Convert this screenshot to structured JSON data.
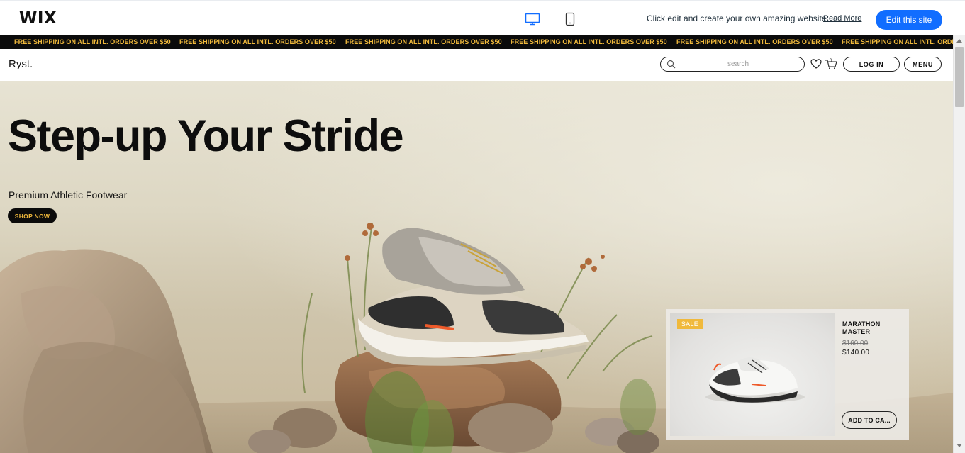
{
  "wix_bar": {
    "logo": "WIX",
    "devices": {
      "desktop_icon": "desktop-icon",
      "mobile_icon": "mobile-icon"
    },
    "promo_text": "Click edit and create your own amazing website",
    "read_more": "Read More",
    "edit_button": "Edit this site",
    "accent_color": "#116dff"
  },
  "announcement": {
    "items": [
      "FREE SHIPPING ON ALL INTL. ORDERS OVER $50",
      "FREE SHIPPING ON ALL INTL. ORDERS OVER $50",
      "FREE SHIPPING ON ALL INTL. ORDERS OVER $50",
      "FREE SHIPPING ON ALL INTL. ORDERS OVER $50",
      "FREE SHIPPING ON ALL INTL. ORDERS OVER $50",
      "FREE SHIPPING ON ALL INTL. ORDERS OVER $50"
    ],
    "text_color": "#f0b93c",
    "background": "#0b0b0b"
  },
  "header": {
    "brand": "Ryst.",
    "search": {
      "placeholder": "search",
      "value": "",
      "icon": "search-icon"
    },
    "wishlist_icon": "heart-icon",
    "cart": {
      "icon": "cart-icon",
      "count": "0"
    },
    "login": "LOG IN",
    "menu": "MENU"
  },
  "hero": {
    "title": "Step-up Your Stride",
    "subtitle": "Premium Athletic Footwear",
    "cta": "SHOP NOW"
  },
  "product_card": {
    "badge": "SALE",
    "name": "MARATHON MASTER",
    "old_price": "$160.00",
    "price": "$140.00",
    "add_to_cart": "ADD TO CA..."
  }
}
